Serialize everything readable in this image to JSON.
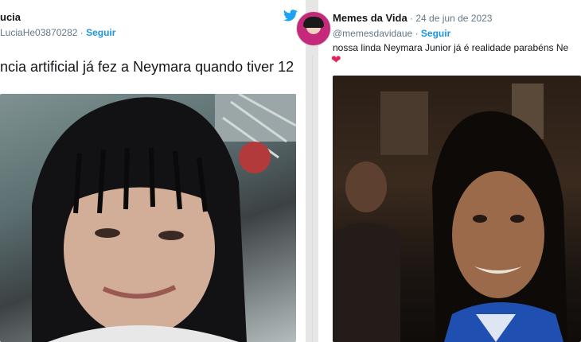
{
  "left_tweet": {
    "author_name": "ucia",
    "handle": "LuciaHe03870282",
    "follow_label": "Seguir",
    "text": "ncia artificial já fez a Neymara quando tiver 12",
    "separator": " · "
  },
  "right_tweet": {
    "author_name": "Memes da Vida",
    "date": "24 de jun de 2023",
    "separator": " · ",
    "handle": "@memesdavidaue",
    "follow_label": "Seguir",
    "text": "nossa linda Neymara Junior já é realidade  parabéns  Ne",
    "heart": "❤"
  },
  "colors": {
    "link_blue": "#1b95e0",
    "twitter_blue": "#1da1f2",
    "heart_red": "#e0245e",
    "muted": "#657786"
  },
  "icons": {
    "bird": "twitter-bird-icon",
    "heart": "heart-icon"
  }
}
